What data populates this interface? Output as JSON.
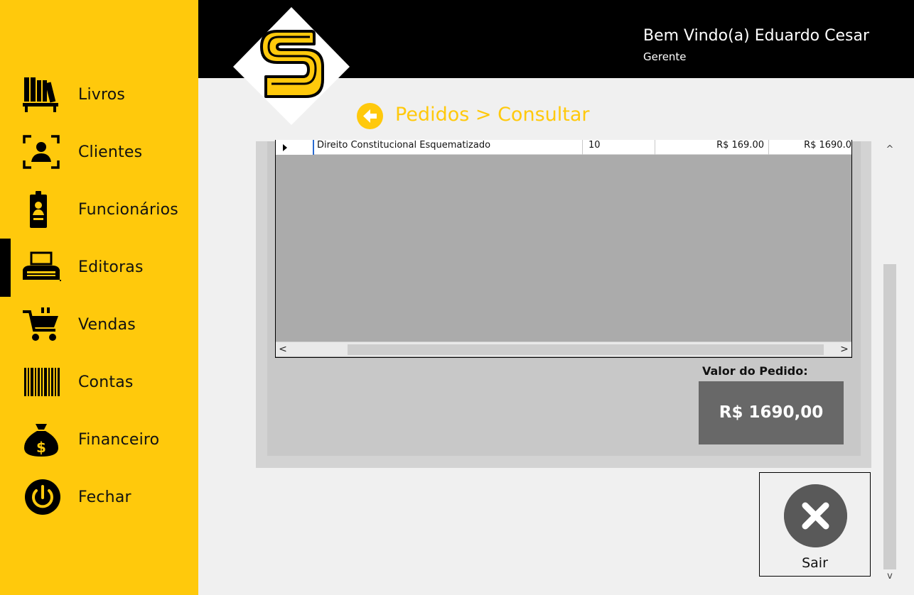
{
  "sidebar": {
    "items": [
      {
        "label": "Livros",
        "icon": "books-icon"
      },
      {
        "label": "Clientes",
        "icon": "client-id-icon"
      },
      {
        "label": "Funcionários",
        "icon": "employee-badge-icon"
      },
      {
        "label": "Editoras",
        "icon": "typewriter-icon"
      },
      {
        "label": "Vendas",
        "icon": "shopping-cart-icon"
      },
      {
        "label": "Contas",
        "icon": "barcode-icon"
      },
      {
        "label": "Financeiro",
        "icon": "money-bag-icon"
      },
      {
        "label": "Fechar",
        "icon": "power-icon"
      }
    ],
    "active": "Editoras"
  },
  "header": {
    "welcome": "Bem Vindo(a) Eduardo Cesar",
    "role": "Gerente"
  },
  "breadcrumb": "Pedidos > Consultar",
  "grid": {
    "rows": [
      {
        "title": "Direito Constitucional Esquematizado",
        "quantity": "10",
        "unit_price": "R$ 169.00",
        "subtotal": "R$ 1690.0"
      }
    ],
    "scroll_left": "<",
    "scroll_right": ">"
  },
  "total": {
    "label": "Valor do Pedido:",
    "value": "R$ 1690,00"
  },
  "exit_button": {
    "label": "Sair"
  },
  "vscroll": {
    "up": "^",
    "down": "v"
  },
  "colors": {
    "accent": "#ffc90c",
    "header_bg": "#000000",
    "total_bg": "#686868"
  }
}
